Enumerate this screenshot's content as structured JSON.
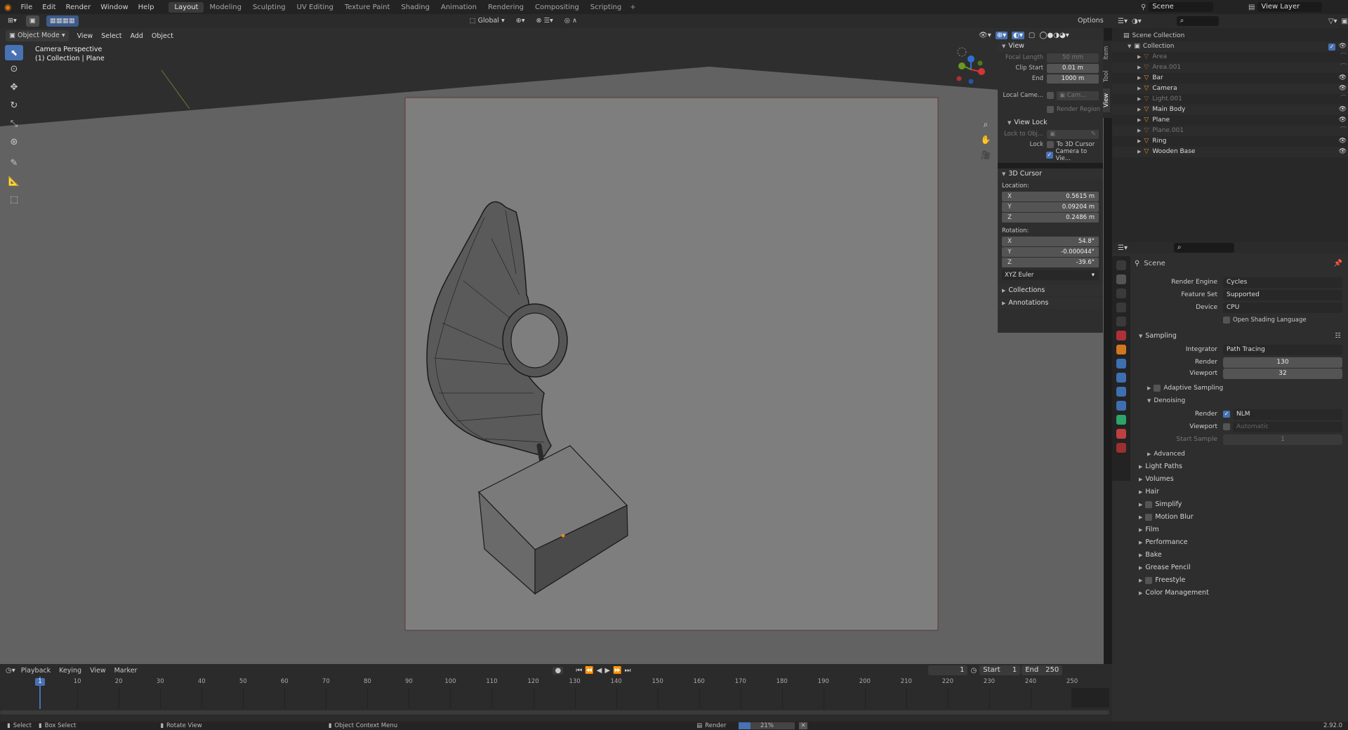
{
  "menu": [
    "File",
    "Edit",
    "Render",
    "Window",
    "Help"
  ],
  "workspaces": [
    "Layout",
    "Modeling",
    "Sculpting",
    "UV Editing",
    "Texture Paint",
    "Shading",
    "Animation",
    "Rendering",
    "Compositing",
    "Scripting"
  ],
  "scene_name": "Scene",
  "view_layer": "View Layer",
  "header": {
    "transform": "Global",
    "options": "Options"
  },
  "viewport": {
    "mode": "Object Mode",
    "menus": [
      "View",
      "Select",
      "Add",
      "Object"
    ],
    "title": "Camera Perspective",
    "subtitle": "(1) Collection | Plane"
  },
  "side_tabs": [
    "Item",
    "Tool",
    "View"
  ],
  "npanel": {
    "view": "View",
    "focal_label": "Focal Length",
    "focal": "50 mm",
    "clip_start_label": "Clip Start",
    "clip_start": "0.01 m",
    "end_label": "End",
    "end": "1000 m",
    "local_cam_label": "Local Came...",
    "local_cam_val": "Cam...",
    "render_region": "Render Region",
    "view_lock": "View Lock",
    "lock_obj_label": "Lock to Obj...",
    "lock_label": "Lock",
    "to_cursor": "To 3D Cursor",
    "cam_to_view": "Camera to Vie...",
    "cursor": "3D Cursor",
    "location": "Location:",
    "loc": [
      [
        "X",
        "0.5615 m"
      ],
      [
        "Y",
        "0.09204 m"
      ],
      [
        "Z",
        "0.2486 m"
      ]
    ],
    "rotation": "Rotation:",
    "rot": [
      [
        "X",
        "54.8°"
      ],
      [
        "Y",
        "-0.000044°"
      ],
      [
        "Z",
        "-39.6°"
      ]
    ],
    "euler": "XYZ Euler",
    "collections": "Collections",
    "annotations": "Annotations"
  },
  "outliner": {
    "root": "Scene Collection",
    "collection": "Collection",
    "items": [
      {
        "name": "Area",
        "dim": true
      },
      {
        "name": "Area.001",
        "dim": true
      },
      {
        "name": "Bar",
        "dim": false
      },
      {
        "name": "Camera",
        "dim": false
      },
      {
        "name": "Light.001",
        "dim": true
      },
      {
        "name": "Main Body",
        "dim": false
      },
      {
        "name": "Plane",
        "dim": false
      },
      {
        "name": "Plane.001",
        "dim": true
      },
      {
        "name": "Ring",
        "dim": false
      },
      {
        "name": "Wooden Base",
        "dim": false
      }
    ]
  },
  "props": {
    "scene": "Scene",
    "render_engine_label": "Render Engine",
    "render_engine": "Cycles",
    "feature_set_label": "Feature Set",
    "feature_set": "Supported",
    "device_label": "Device",
    "device": "CPU",
    "osl": "Open Shading Language",
    "sampling": "Sampling",
    "integrator_label": "Integrator",
    "integrator": "Path Tracing",
    "render_label": "Render",
    "render_val": "130",
    "viewport_label": "Viewport",
    "viewport_val": "32",
    "adaptive": "Adaptive Sampling",
    "denoising": "Denoising",
    "dn_render_label": "Render",
    "dn_render": "NLM",
    "dn_viewport_label": "Viewport",
    "dn_viewport": "Automatic",
    "start_sample_label": "Start Sample",
    "start_sample": "1",
    "advanced": "Advanced",
    "sections": [
      "Light Paths",
      "Volumes",
      "Hair",
      "Simplify",
      "Motion Blur",
      "Film",
      "Performance",
      "Bake",
      "Grease Pencil",
      "Freestyle",
      "Color Management"
    ]
  },
  "timeline": {
    "menus": [
      "Playback",
      "Keying",
      "View",
      "Marker"
    ],
    "current": "1",
    "start_label": "Start",
    "start": "1",
    "end_label": "End",
    "end": "250",
    "ticks": [
      "1",
      "10",
      "20",
      "30",
      "40",
      "50",
      "60",
      "70",
      "80",
      "90",
      "100",
      "110",
      "120",
      "130",
      "140",
      "150",
      "160",
      "170",
      "180",
      "190",
      "200",
      "210",
      "220",
      "230",
      "240",
      "250"
    ]
  },
  "status": {
    "select": "Select",
    "box_select": "Box Select",
    "rotate": "Rotate View",
    "context": "Object Context Menu",
    "render": "Render",
    "progress": "21%",
    "progress_value": 0.21,
    "version": "2.92.0"
  }
}
